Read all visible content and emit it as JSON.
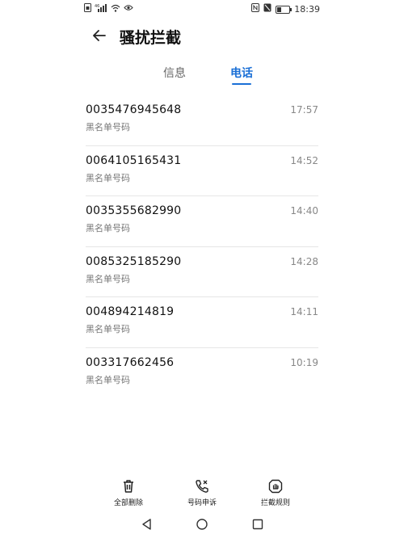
{
  "status_bar": {
    "time": "18:39",
    "signal_text": "⁴⁶",
    "icons": [
      "sim-icon",
      "signal-icon",
      "wifi-icon",
      "eye-icon",
      "nfc-icon",
      "mute-icon",
      "battery-icon"
    ]
  },
  "header": {
    "title": "骚扰拦截"
  },
  "tabs": [
    {
      "label": "信息",
      "active": false
    },
    {
      "label": "电话",
      "active": true
    }
  ],
  "calls": [
    {
      "number": "0035476945648",
      "tag": "黑名单号码",
      "time": "17:57"
    },
    {
      "number": "0064105165431",
      "tag": "黑名单号码",
      "time": "14:52"
    },
    {
      "number": "0035355682990",
      "tag": "黑名单号码",
      "time": "14:40"
    },
    {
      "number": "0085325185290",
      "tag": "黑名单号码",
      "time": "14:28"
    },
    {
      "number": "004894214819",
      "tag": "黑名单号码",
      "time": "14:11"
    },
    {
      "number": "003317662456",
      "tag": "黑名单号码",
      "time": "10:19"
    }
  ],
  "actions": {
    "delete_all": "全部删除",
    "appeal": "号码申诉",
    "rules": "拦截规则"
  },
  "colors": {
    "accent": "#1a6fd6",
    "divider": "#e6e6e6"
  }
}
